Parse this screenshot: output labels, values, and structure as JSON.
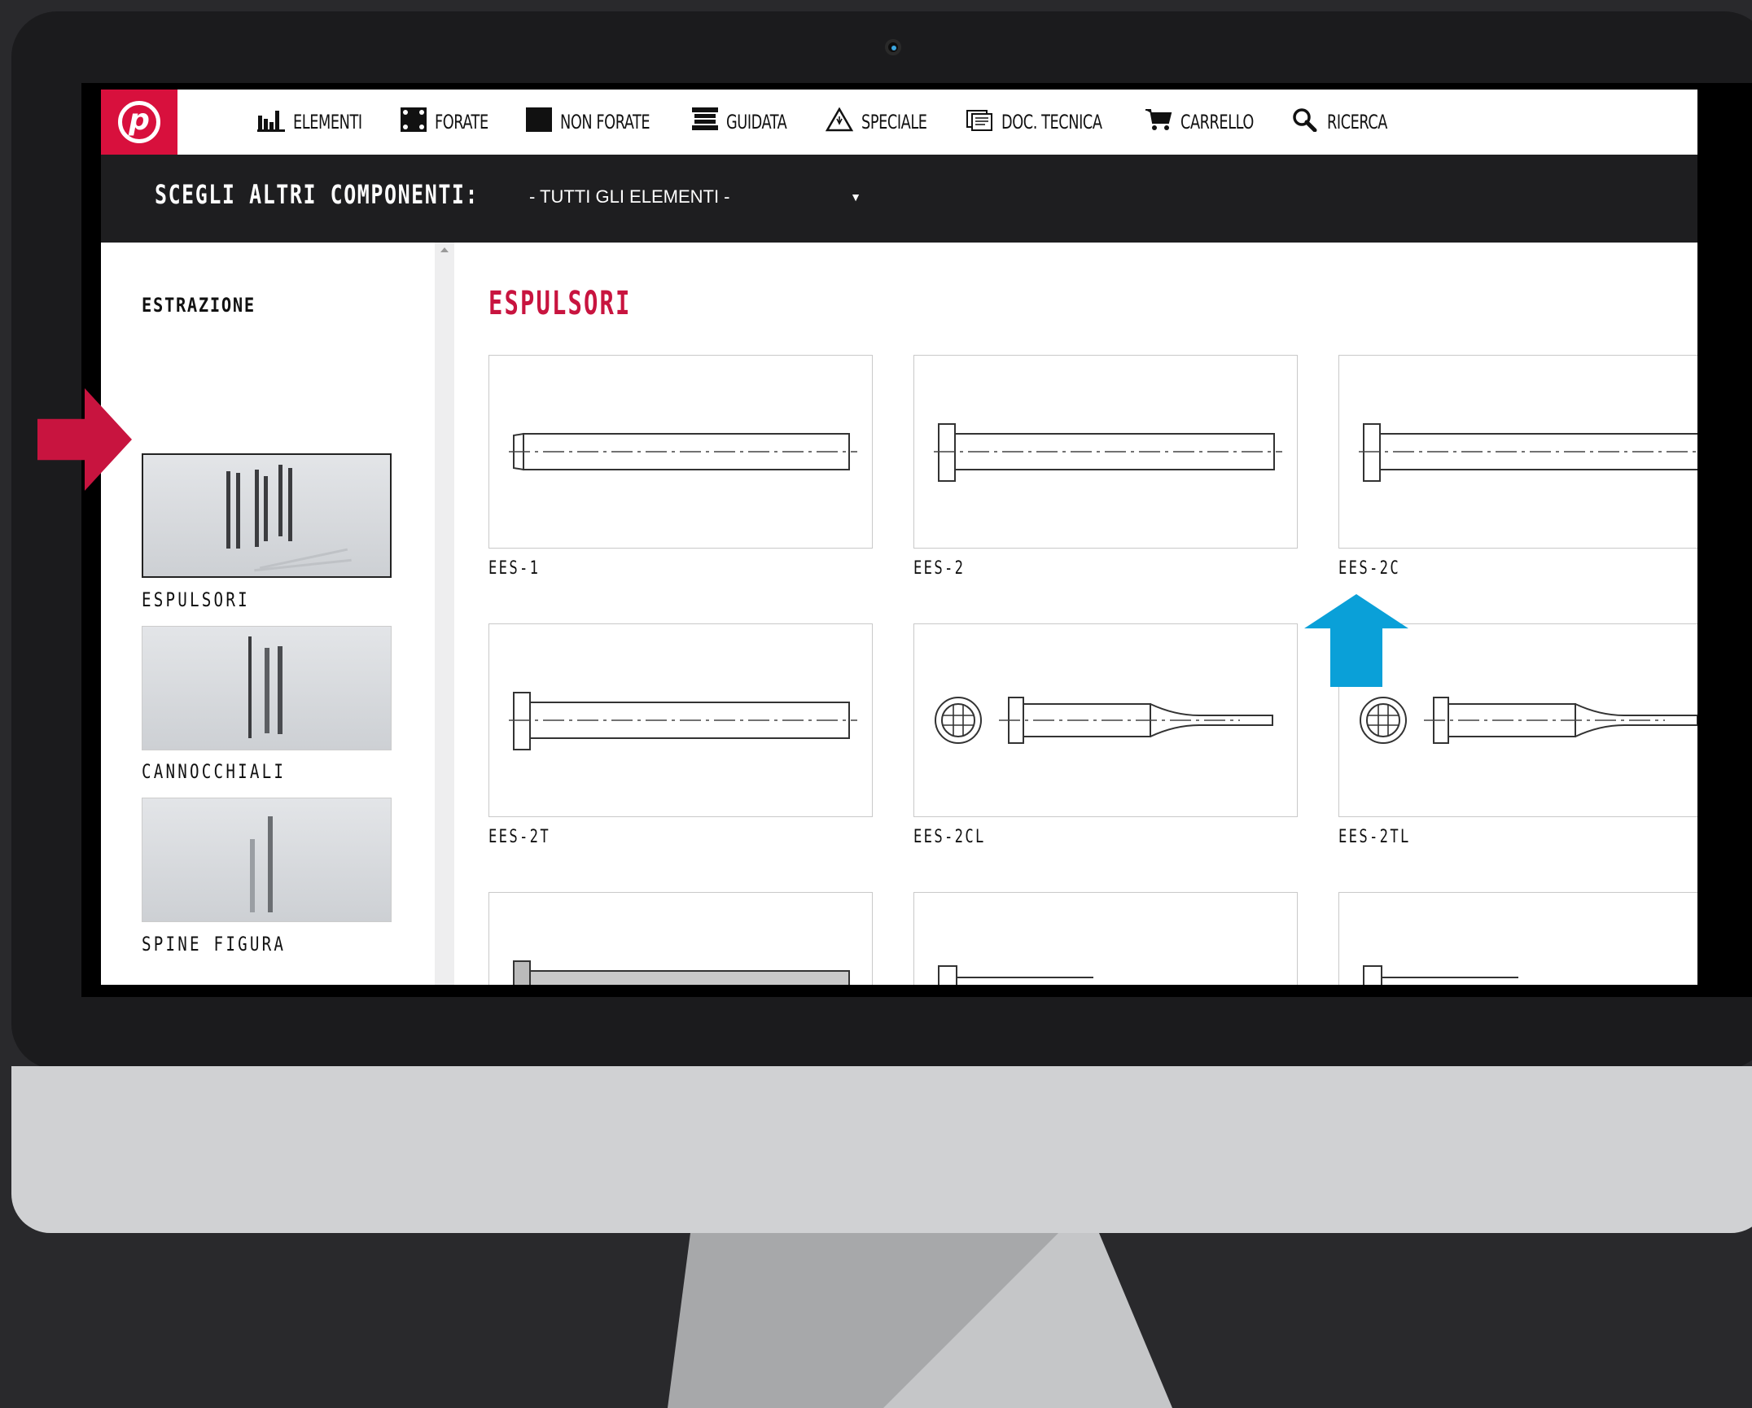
{
  "nav": {
    "logo_letter": "p",
    "items": [
      {
        "label": "ELEMENTI",
        "icon": "bar-chart-icon"
      },
      {
        "label": "FORATE",
        "icon": "perforated-plate-icon"
      },
      {
        "label": "NON FORATE",
        "icon": "solid-plate-icon"
      },
      {
        "label": "GUIDATA",
        "icon": "guided-mold-icon"
      },
      {
        "label": "SPECIALE",
        "icon": "warning-triangle-icon"
      },
      {
        "label": "DOC. TECNICA",
        "icon": "document-icon"
      },
      {
        "label": "CARRELLO",
        "icon": "cart-icon"
      },
      {
        "label": "RICERCA",
        "icon": "search-icon"
      }
    ]
  },
  "subbar": {
    "label": "SCEGLI ALTRI COMPONENTI:",
    "select_value": "- TUTTI GLI ELEMENTI -"
  },
  "sidebar": {
    "title": "ESTRAZIONE",
    "items": [
      {
        "label": "ESPULSORI",
        "selected": true
      },
      {
        "label": "CANNOCCHIALI",
        "selected": false
      },
      {
        "label": "SPINE FIGURA",
        "selected": false
      }
    ]
  },
  "content": {
    "title": "ESPULSORI",
    "products": [
      {
        "code": "EES-1",
        "drawing": "ejector-pin-tapered-head"
      },
      {
        "code": "EES-2",
        "drawing": "ejector-pin-flat-head"
      },
      {
        "code": "EES-2C",
        "drawing": "ejector-pin-flat-head"
      },
      {
        "code": "EES-2T",
        "drawing": "ejector-pin-flat-head"
      },
      {
        "code": "EES-2CL",
        "drawing": "stepped-ejector-pin"
      },
      {
        "code": "EES-2TL",
        "drawing": "stepped-ejector-pin"
      }
    ]
  },
  "colors": {
    "brand_red": "#d8103d",
    "title_red": "#c8143f",
    "annotation_blue": "#0aa0d8",
    "dark_bar": "#1e1e20"
  }
}
